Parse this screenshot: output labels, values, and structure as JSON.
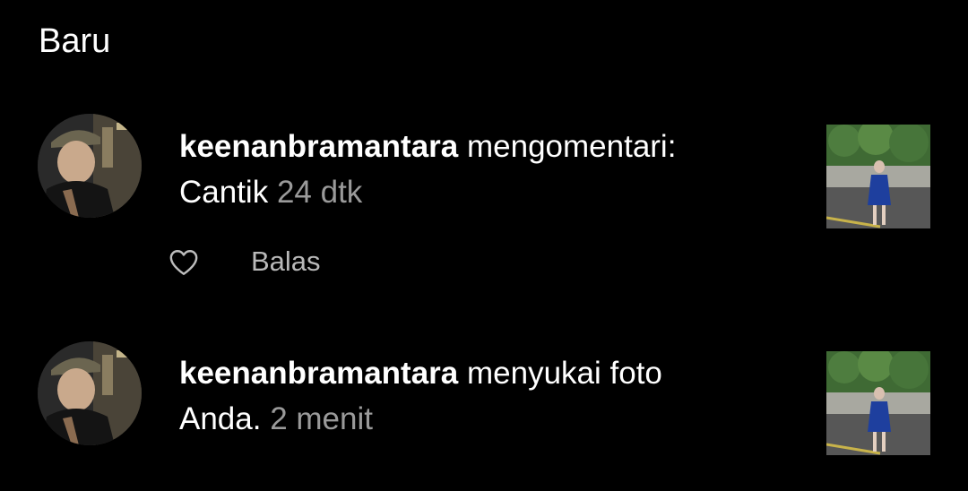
{
  "section": {
    "title": "Baru"
  },
  "notifications": [
    {
      "username": "keenanbramantara",
      "action": " mengomentari:",
      "line2": "Cantik",
      "time": " 24 dtk",
      "reply_label": "Balas",
      "like_icon": "heart-outline-icon"
    },
    {
      "username": "keenanbramantara",
      "action": " menyukai foto",
      "line2": "Anda.",
      "time": " 2 menit"
    }
  ],
  "colors": {
    "background": "#000000",
    "text": "#ffffff",
    "muted": "#9a9a9a"
  }
}
